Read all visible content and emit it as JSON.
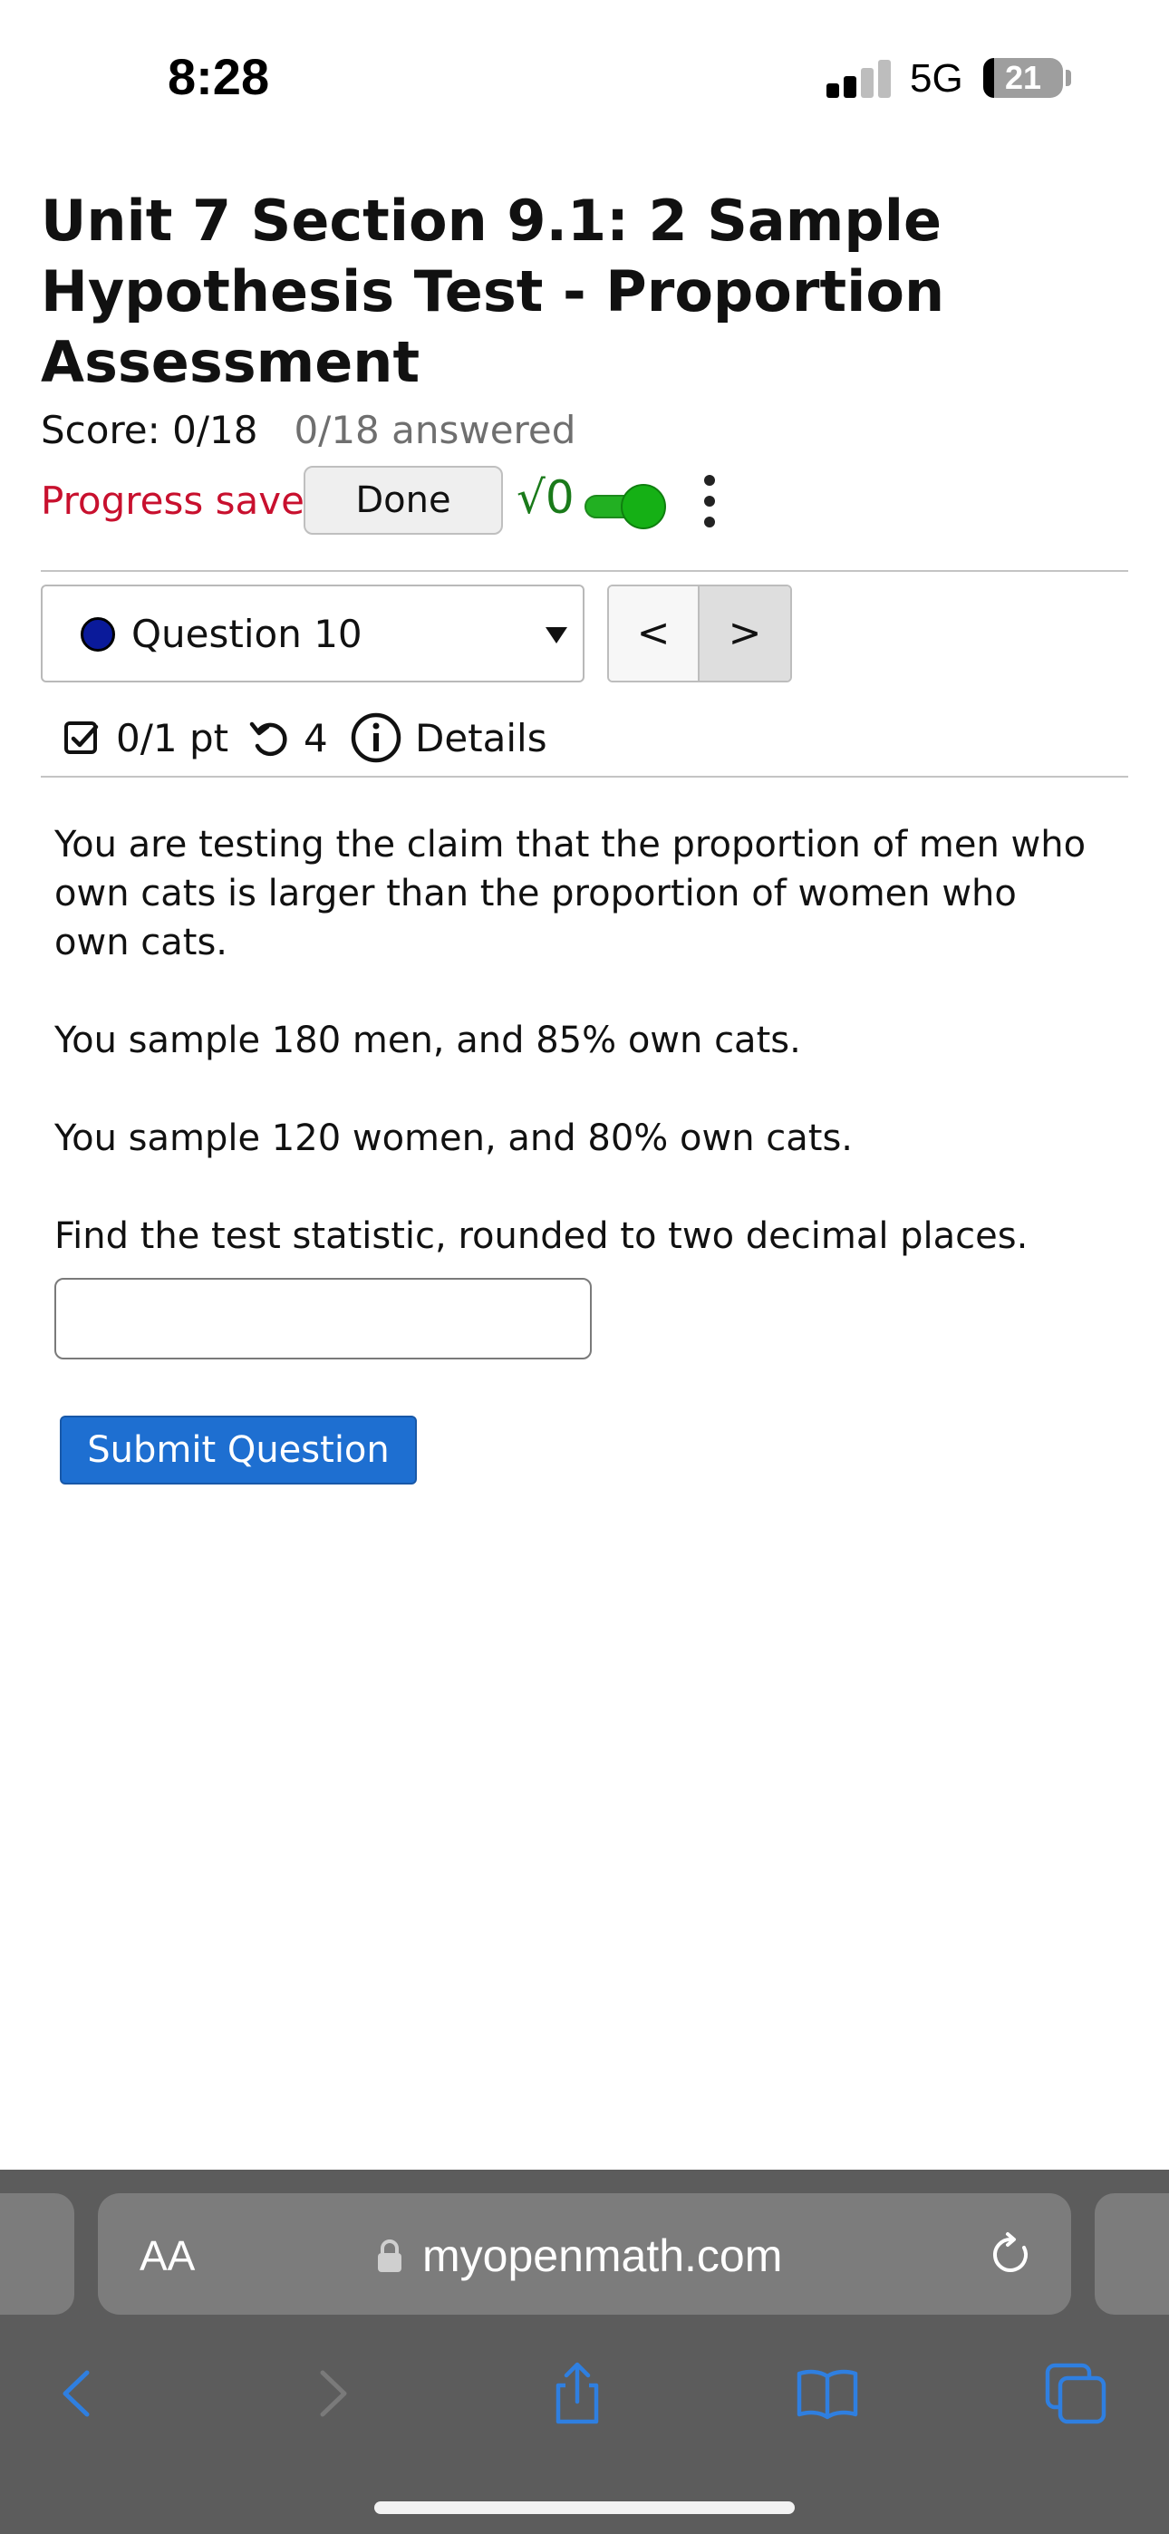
{
  "status_bar": {
    "time": "8:28",
    "network": "5G",
    "battery": "21"
  },
  "header": {
    "title": "Unit 7 Section 9.1: 2 Sample Hypothesis Test - Proportion Assessment",
    "score": "Score: 0/18",
    "answered": "0/18 answered",
    "progress_saved": "Progress saved",
    "done_label": "Done",
    "math_toggle_label": "√0"
  },
  "question_nav": {
    "selected": "Question 10",
    "prev_label": "<",
    "next_label": ">"
  },
  "meta": {
    "points": "0/1 pt",
    "tries": "4",
    "details_label": "Details"
  },
  "question": {
    "paragraphs": [
      "You are testing the claim that the proportion of men who own cats is larger than the proportion of women who own cats.",
      "You sample 180 men, and 85% own cats.",
      "You sample 120 women, and 80% own cats.",
      "Find the test statistic, rounded to two decimal places."
    ],
    "answer_value": "",
    "submit_label": "Submit Question"
  },
  "browser": {
    "aa_label": "AA",
    "url": "myopenmath.com"
  },
  "colors": {
    "progress_saved": "#c8102e",
    "submit_button": "#1e6fd1",
    "math_toggle": "#15b015",
    "question_dot": "#0a1a9a",
    "browser_bar": "#5c5c5c",
    "browser_icons": "#2f7fe0"
  }
}
